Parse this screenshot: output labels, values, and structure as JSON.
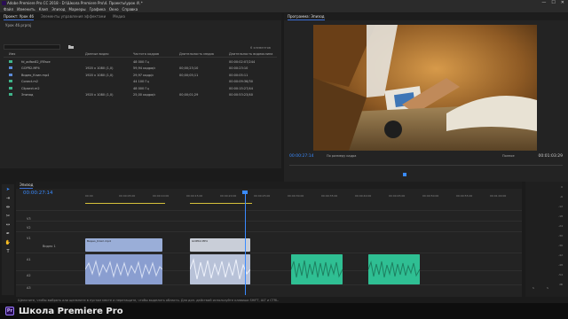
{
  "window": {
    "title": "Adobe Premiere Pro CC 2018 - D:\\Школа Premiere Pro\\4. Проекты\\урок 4\\ *",
    "controls": [
      "—",
      "☐",
      "✕"
    ]
  },
  "menu": [
    "Файл",
    "Изменить",
    "Клип",
    "Эпизод",
    "Маркеры",
    "Графика",
    "Окно",
    "Справка"
  ],
  "project": {
    "tabs": [
      "Проект: Урок 4б",
      "Элементы управления эффектами",
      "Медиа"
    ],
    "path": "Урок 4б.prproj",
    "count": "6 элементов",
    "columns": [
      "Имя",
      "Данные видео",
      "Частота кадров",
      "Длительность медиа",
      "Длительность видеоклипа"
    ],
    "rows": [
      {
        "name": "fd_adfan82_lRFace",
        "vinfo": "",
        "fps": "48 000 Гц",
        "media": "",
        "clip": "00:00:02:07/244",
        "color": "#3fb58b"
      },
      {
        "name": "GOPR2.MP4",
        "vinfo": "1920 x 1080 (1,0)",
        "fps": "59,94 кадра/с",
        "media": "00;00;23;10",
        "clip": "00:00:23:10",
        "color": "#5b8bd8"
      },
      {
        "name": "Видео_Клип.mp4",
        "vinfo": "1920 x 1080 (1,0)",
        "fps": "29,97 кадр/с",
        "media": "00;00;05;11",
        "clip": "00:00:05:11",
        "color": "#5b8bd8"
      },
      {
        "name": "Сonect.m2",
        "vinfo": "",
        "fps": "44 100 Гц",
        "media": "",
        "clip": "00:00:09:36/30",
        "color": "#3fb58b"
      },
      {
        "name": "Сlipsect.m2",
        "vinfo": "",
        "fps": "48 000 Гц",
        "media": "",
        "clip": "00:00:15:27/44",
        "color": "#3fb58b"
      },
      {
        "name": "Эпизод",
        "vinfo": "1920 x 1080 (1,0)",
        "fps": "25,00 кадра/с",
        "media": "00;00;01;29",
        "clip": "00:00:53:23/40",
        "color": "#3fb58b"
      }
    ]
  },
  "program": {
    "tab": "Программа: Эпизод",
    "timecode": "00:00:27:14",
    "fit": "По размеру кадра",
    "quality": "Полное",
    "duration": "00:01:03:29",
    "controls": [
      "⯆",
      "|",
      "|",
      "⇤",
      "◀|",
      "▶",
      "|▶",
      "⇥",
      "⊕",
      "⊖",
      "⊞",
      "⊙",
      "+"
    ]
  },
  "timeline": {
    "tab": "Эпизод",
    "timecode": "00:00:27:14",
    "ruler": [
      "00:00",
      "00:00:05:00",
      "00:00:10:00",
      "00:00:15:00",
      "00:00:20:00",
      "00:00:25:00",
      "00:00:30:00",
      "00:00:35:00",
      "00:00:40:00",
      "00:00:45:00",
      "00:00:50:00",
      "00:00:55:00",
      "00:01:00:00"
    ],
    "tracks": [
      "V3",
      "V2",
      "V1",
      "A1",
      "A2",
      "A3"
    ],
    "track_label_v1": "Видео 1",
    "clips": [
      {
        "label": "Видео_Клип.mp4"
      },
      {
        "label": "GOPR2.MP4"
      }
    ]
  },
  "meter_labels": [
    "0",
    "-6",
    "-12",
    "-18",
    "-24",
    "-30",
    "-36",
    "-42",
    "-48",
    "-54",
    "dB"
  ],
  "meter_channels": [
    "S",
    "S"
  ],
  "status_text": "Щелкните, чтобы выбрать или щелкните в пустом месте и перетащите, чтобы выделить область. Для доп. действий используйте клавиши SHIFT, ALT и CTRL.",
  "brand": "Школа Premiere Pro",
  "brand_logo": "Pr"
}
